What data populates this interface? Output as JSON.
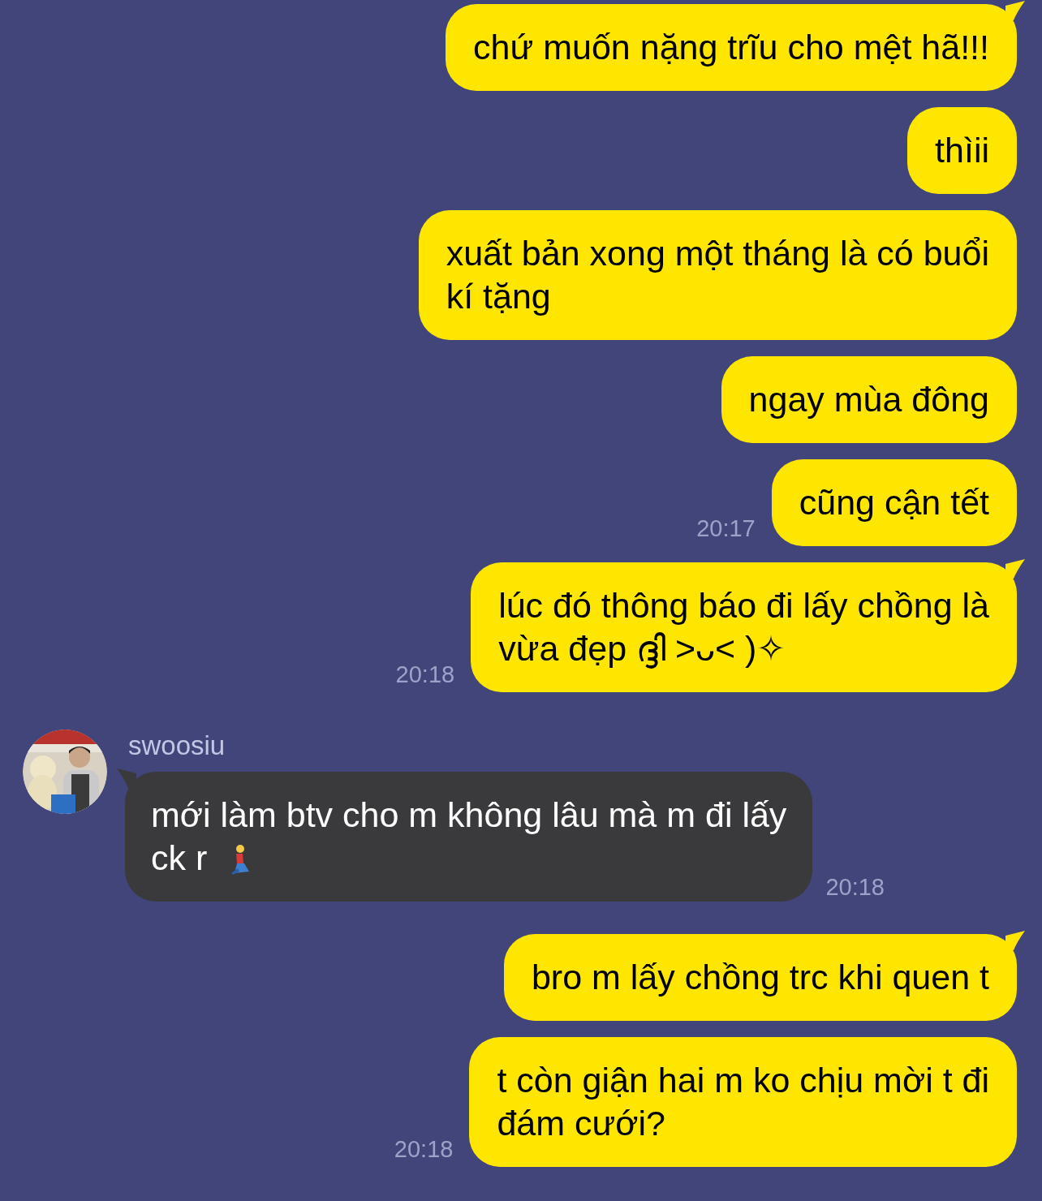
{
  "messages": [
    {
      "kind": "sent",
      "lines": [
        "chứ muốn nặng trĩu cho mệt hã!!!"
      ],
      "tail": true
    },
    {
      "kind": "sent",
      "lines": [
        "thìii"
      ],
      "tail": false
    },
    {
      "kind": "sent",
      "lines": [
        "xuất bản xong một tháng là có buổi",
        "kí tặng"
      ],
      "tail": false
    },
    {
      "kind": "sent",
      "lines": [
        "ngay mùa đông"
      ],
      "tail": false
    },
    {
      "kind": "sent",
      "lines": [
        "cũng cận tết"
      ],
      "tail": false,
      "time": "20:17"
    },
    {
      "kind": "sent",
      "lines": [
        "lúc đó thông báo đi lấy chồng là",
        "vừa đẹp ദ്ദി ˃ᴗ˂ )✧"
      ],
      "tail": true,
      "time": "20:18"
    },
    {
      "kind": "received",
      "sender": "swoosiu",
      "lines": [
        "mới làm btv cho m không lâu mà m đi lấy",
        "ck r"
      ],
      "tail": true,
      "time": "20:18",
      "emoji": true
    },
    {
      "kind": "sent",
      "lines": [
        "bro m lấy chồng trc khi quen t"
      ],
      "tail": true
    },
    {
      "kind": "sent",
      "lines": [
        "t còn giận hai m ko chịu mời t đi",
        "đám cưới?"
      ],
      "tail": false,
      "time": "20:18"
    }
  ]
}
